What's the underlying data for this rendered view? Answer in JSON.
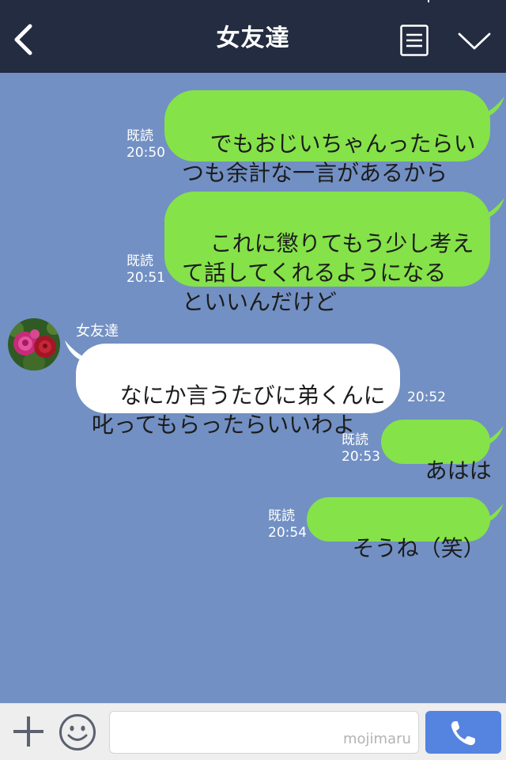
{
  "header": {
    "title": "女友達",
    "back_icon": "chevron-left-icon",
    "menu_icon": "list-icon",
    "more_icon": "chevron-down-icon"
  },
  "messages": [
    {
      "side": "out",
      "text": "でもおじいちゃんったらい\nつも余計な一言があるから",
      "read": "既読",
      "time": "20:50"
    },
    {
      "side": "out",
      "text": "これに懲りてもう少し考え\nて話してくれるようになる\nといいんだけど",
      "read": "既読",
      "time": "20:51"
    },
    {
      "side": "in",
      "sender": "女友達",
      "text": "なにか言うたびに弟くんに\n叱ってもらったらいいわよ",
      "time": "20:52"
    },
    {
      "side": "out",
      "text": "あはは",
      "read": "既読",
      "time": "20:53"
    },
    {
      "side": "out",
      "text": "そうね（笑）",
      "read": "既読",
      "time": "20:54"
    }
  ],
  "footer": {
    "plus_icon": "plus-icon",
    "emoji_icon": "smiley-icon",
    "input_value": "",
    "watermark": "mojimaru",
    "call_icon": "phone-icon"
  },
  "colors": {
    "header_bg": "#232c40",
    "chat_bg": "#7290c3",
    "outgoing_bubble": "#85e249",
    "incoming_bubble": "#ffffff",
    "call_button": "#5583e0"
  }
}
